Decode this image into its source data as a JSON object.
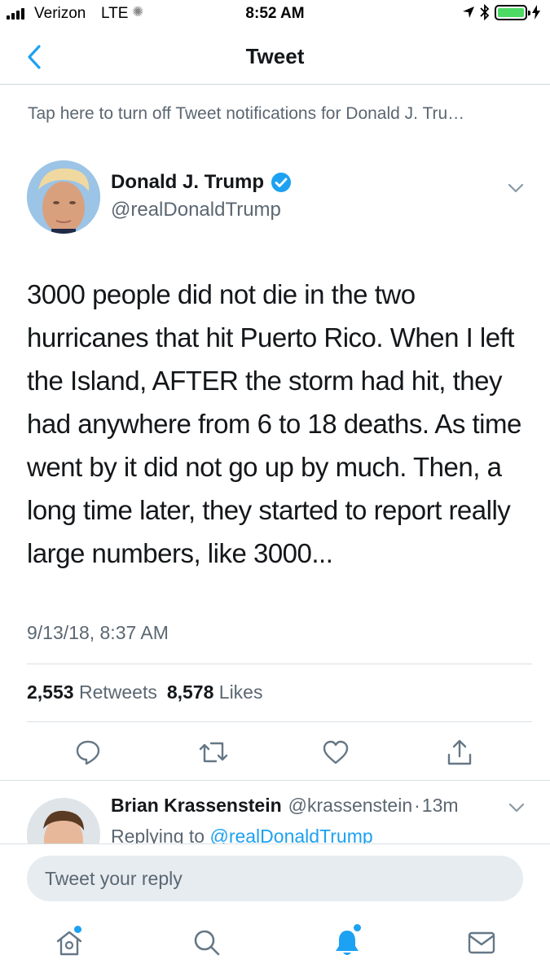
{
  "status_bar": {
    "carrier": "Verizon",
    "network": "LTE",
    "time": "8:52 AM",
    "battery_level": 1.0
  },
  "nav": {
    "title": "Tweet"
  },
  "notification_banner": "Tap here to turn off Tweet notifications for Donald J. Tru…",
  "tweet": {
    "author_name": "Donald J. Trump",
    "author_handle": "@realDonaldTrump",
    "verified": true,
    "text": "3000 people did not die in the two hurricanes that hit Puerto Rico. When I left the Island, AFTER the storm had hit, they had anywhere from 6 to 18 deaths. As time went by it did not go up by much. Then, a long time later, they started to report really large numbers, like 3000...",
    "timestamp": "9/13/18, 8:37 AM",
    "retweets_count": "2,553",
    "retweets_label": "Retweets",
    "likes_count": "8,578",
    "likes_label": "Likes"
  },
  "reply": {
    "name": "Brian Krassenstein",
    "handle": "@krassenstein",
    "separator": "·",
    "time": "13m",
    "replying_prefix": "Replying to",
    "replying_handle": "@realDonaldTrump"
  },
  "composer": {
    "placeholder": "Tweet your reply"
  },
  "colors": {
    "accent": "#1da1f2",
    "text": "#14171a",
    "secondary": "#5b6772",
    "battery": "#4cd964"
  },
  "icons": {
    "back": "chevron-left-icon",
    "verified": "verified-badge-icon",
    "caret": "chevron-down-icon",
    "reply": "comment-icon",
    "retweet": "retweet-icon",
    "like": "heart-icon",
    "share": "share-icon",
    "home": "home-icon",
    "search": "search-icon",
    "notifications": "bell-icon",
    "messages": "mail-icon"
  }
}
